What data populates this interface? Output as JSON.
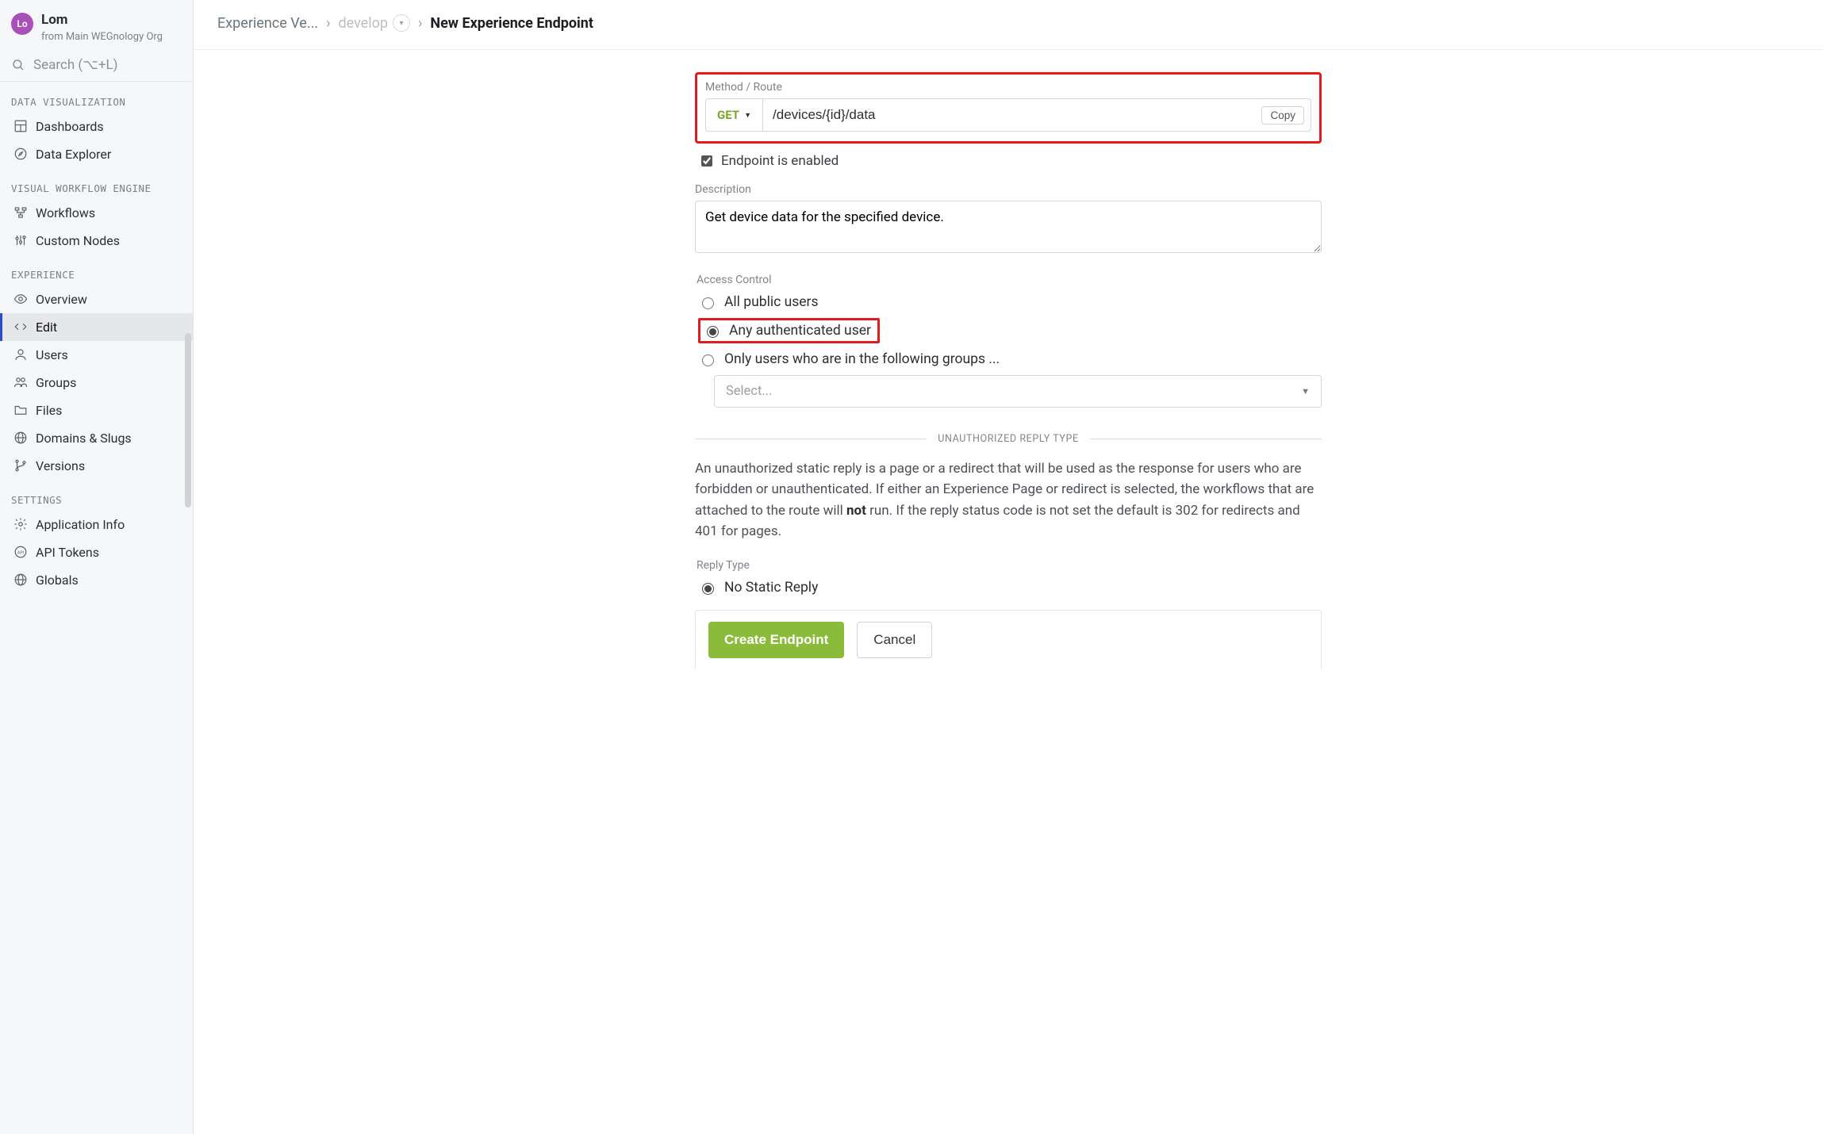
{
  "sidebar": {
    "avatar_initials": "Lo",
    "title": "Lom",
    "subtitle": "from Main WEGnology Org",
    "search_placeholder": "Search (⌥+L)",
    "sections": {
      "viz": {
        "title": "DATA VISUALIZATION",
        "items": [
          "Dashboards",
          "Data Explorer"
        ]
      },
      "wf": {
        "title": "VISUAL WORKFLOW ENGINE",
        "items": [
          "Workflows",
          "Custom Nodes"
        ]
      },
      "exp": {
        "title": "EXPERIENCE",
        "items": [
          "Overview",
          "Edit",
          "Users",
          "Groups",
          "Files",
          "Domains & Slugs",
          "Versions"
        ]
      },
      "set": {
        "title": "SETTINGS",
        "items": [
          "Application Info",
          "API Tokens",
          "Globals"
        ]
      }
    }
  },
  "breadcrumbs": {
    "root": "Experience Ve...",
    "dev": "develop",
    "current": "New Experience Endpoint"
  },
  "form": {
    "method_route_label": "Method / Route",
    "method": "GET",
    "route": "/devices/{id}/data",
    "copy": "Copy",
    "enabled_label": "Endpoint is enabled",
    "enabled_checked": true,
    "description_label": "Description",
    "description_value": "Get device data for the specified device.",
    "access_label": "Access Control",
    "access_options": {
      "public": "All public users",
      "auth": "Any authenticated user",
      "groups": "Only users who are in the following groups ..."
    },
    "access_selected": "auth",
    "groups_select_placeholder": "Select...",
    "unauth_divider": "UNAUTHORIZED REPLY TYPE",
    "unauth_text_a": "An unauthorized static reply is a page or a redirect that will be used as the response for users who are forbidden or unauthenticated. If either an Experience Page or redirect is selected, the workflows that are attached to the route will ",
    "unauth_bold": "not",
    "unauth_text_b": " run. If the reply status code is not set the default is 302 for redirects and 401 for pages.",
    "reply_type_label": "Reply Type",
    "reply_no_static": "No Static Reply",
    "buttons": {
      "create": "Create Endpoint",
      "cancel": "Cancel"
    }
  }
}
